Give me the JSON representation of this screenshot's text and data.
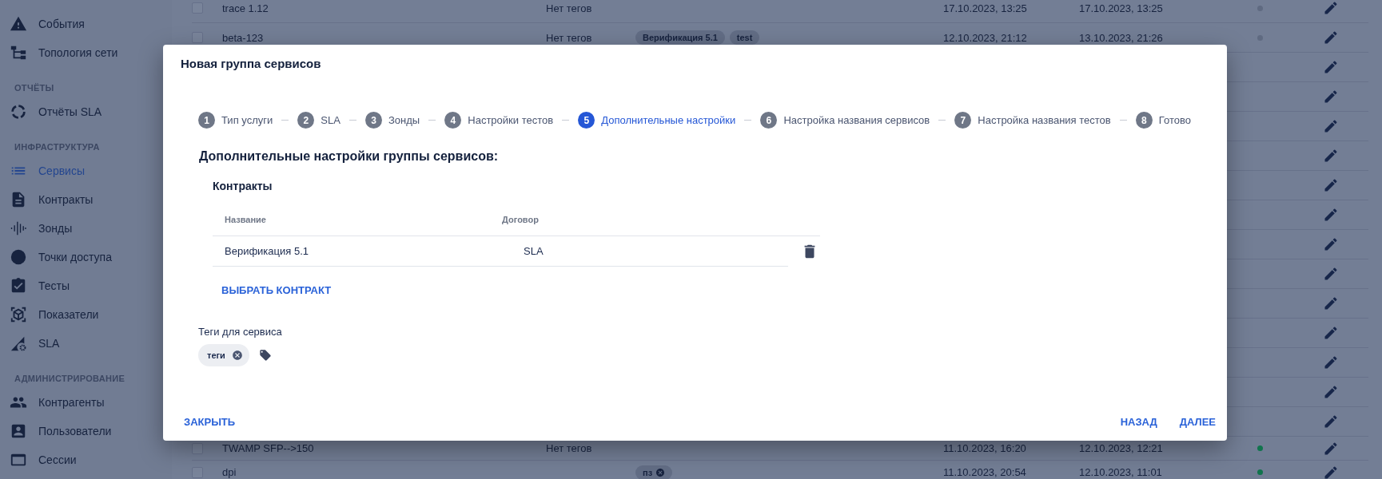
{
  "sidebar": {
    "items": [
      {
        "kind": "link",
        "label": "События",
        "selected": false
      },
      {
        "kind": "link",
        "label": "Топология сети",
        "selected": false
      },
      {
        "kind": "section",
        "label": "ОТЧЁТЫ"
      },
      {
        "kind": "link",
        "label": "Отчёты SLA",
        "selected": false
      },
      {
        "kind": "section",
        "label": "ИНФРАСТРУКТУРА"
      },
      {
        "kind": "link",
        "label": "Сервисы",
        "selected": true
      },
      {
        "kind": "link",
        "label": "Контракты",
        "selected": false
      },
      {
        "kind": "link",
        "label": "Зонды",
        "selected": false
      },
      {
        "kind": "link",
        "label": "Точки доступа",
        "selected": false
      },
      {
        "kind": "link",
        "label": "Тесты",
        "selected": false
      },
      {
        "kind": "link",
        "label": "Показатели",
        "selected": false
      },
      {
        "kind": "link",
        "label": "SLA",
        "selected": false
      },
      {
        "kind": "section",
        "label": "АДМИНИСТРИРОВАНИЕ"
      },
      {
        "kind": "link",
        "label": "Контрагенты",
        "selected": false
      },
      {
        "kind": "link",
        "label": "Пользователи",
        "selected": false
      },
      {
        "kind": "link",
        "label": "Сессии",
        "selected": false
      }
    ]
  },
  "services_table": {
    "rows": [
      {
        "kind": "row",
        "checked": false,
        "name": "trace 1.12",
        "tags_text": "Нет тегов",
        "created": "17.10.2023, 13:25",
        "updated": "17.10.2023, 13:25",
        "color": "#5f6a81"
      },
      {
        "kind": "row",
        "checked": false,
        "name": "beta-123",
        "tags_text": "Нет тегов",
        "tags": [
          {
            "label": "Верификация 5.1",
            "removable": false
          },
          {
            "label": "test",
            "removable": false
          }
        ],
        "created": "12.10.2023, 21:12",
        "updated": "13.10.2023, 21:26",
        "color": "#5f6a81"
      },
      {
        "kind": "covered"
      },
      {
        "kind": "covered"
      },
      {
        "kind": "covered"
      },
      {
        "kind": "covered"
      },
      {
        "kind": "covered"
      },
      {
        "kind": "covered"
      },
      {
        "kind": "covered"
      },
      {
        "kind": "covered"
      },
      {
        "kind": "covered"
      },
      {
        "kind": "covered"
      },
      {
        "kind": "covered"
      },
      {
        "kind": "covered"
      },
      {
        "kind": "covered"
      },
      {
        "kind": "row",
        "checked": false,
        "name": "TWAMP SFP-->150",
        "tags_text": "Нет тегов",
        "created": "11.10.2023, 16:20",
        "updated": "12.10.2023, 12:21",
        "color": "#11744d"
      },
      {
        "kind": "row",
        "checked": false,
        "name": "dpi",
        "tags": [
          {
            "label": "пз",
            "removable": true
          }
        ],
        "created": "11.10.2023, 20:54",
        "updated": "12.10.2023, 11:01",
        "color": "#11744d"
      }
    ]
  },
  "dialog": {
    "title": "Новая группа сервисов",
    "steps": [
      {
        "number": "1",
        "label": "Тип услуги",
        "selected": false
      },
      {
        "number": "2",
        "label": "SLA",
        "selected": false
      },
      {
        "number": "3",
        "label": "Зонды",
        "selected": false
      },
      {
        "number": "4",
        "label": "Настройки тестов",
        "selected": false
      },
      {
        "number": "5",
        "label": "Дополнительные настройки",
        "selected": true
      },
      {
        "number": "6",
        "label": "Настройка названия сервисов",
        "selected": false
      },
      {
        "number": "7",
        "label": "Настройка названия тестов",
        "selected": false
      },
      {
        "number": "8",
        "label": "Готово",
        "selected": false
      }
    ],
    "heading": "Дополнительные настройки группы сервисов:",
    "contracts": {
      "title": "Контракты",
      "columns": [
        "Название",
        "Договор"
      ],
      "rows": [
        {
          "name": "Верификация 5.1",
          "contract": "SLA"
        }
      ],
      "add_button": "ВЫБРАТЬ КОНТРАКТ"
    },
    "tags": {
      "label": "Теги для сервиса",
      "chips": [
        {
          "label": "теги",
          "removable": true
        }
      ]
    },
    "close_button": "ЗАКРЫТЬ",
    "back_button": "НАЗАД",
    "next_button": "ДАЛЕЕ"
  }
}
